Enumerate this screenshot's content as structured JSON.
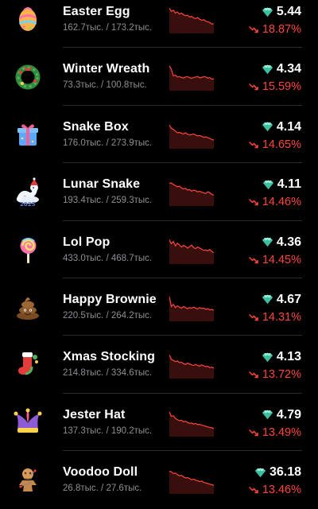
{
  "colors": {
    "background": "#000000",
    "name_text": "#ffffff",
    "stats_text": "#8e8e93",
    "negative": "#ff453a",
    "gem": "#5ee0c0"
  },
  "items": [
    {
      "name": "Easter Egg",
      "stats": "162.7тыс. / 173.2тыс.",
      "price": "5.44",
      "change": "18.87%",
      "icon": "easter-egg-icon",
      "trend": [
        0.08,
        0.22,
        0.18,
        0.3,
        0.25,
        0.35,
        0.3,
        0.38,
        0.42,
        0.4,
        0.48,
        0.45,
        0.52,
        0.55,
        0.5,
        0.58,
        0.62,
        0.6,
        0.66,
        0.7,
        0.72,
        0.8,
        0.78
      ]
    },
    {
      "name": "Winter Wreath",
      "stats": "73.3тыс. / 100.8тыс.",
      "price": "4.34",
      "change": "15.59%",
      "icon": "wreath-icon",
      "trend": [
        0.1,
        0.25,
        0.55,
        0.52,
        0.6,
        0.58,
        0.62,
        0.65,
        0.6,
        0.58,
        0.63,
        0.66,
        0.62,
        0.6,
        0.58,
        0.64,
        0.62,
        0.58,
        0.6,
        0.65,
        0.63,
        0.7,
        0.68
      ]
    },
    {
      "name": "Snake Box",
      "stats": "176.0тыс. / 273.9тыс.",
      "price": "4.14",
      "change": "14.65%",
      "icon": "gift-box-icon",
      "trend": [
        0.15,
        0.3,
        0.35,
        0.42,
        0.5,
        0.48,
        0.52,
        0.55,
        0.5,
        0.56,
        0.6,
        0.58,
        0.55,
        0.6,
        0.64,
        0.62,
        0.66,
        0.7,
        0.68,
        0.72,
        0.75,
        0.8,
        0.82
      ]
    },
    {
      "name": "Lunar Snake",
      "stats": "193.4тыс. / 259.3тыс.",
      "price": "4.11",
      "change": "14.46%",
      "icon": "snake-icon",
      "trend": [
        0.2,
        0.18,
        0.25,
        0.3,
        0.35,
        0.32,
        0.4,
        0.45,
        0.42,
        0.5,
        0.48,
        0.55,
        0.5,
        0.53,
        0.58,
        0.55,
        0.6,
        0.62,
        0.65,
        0.58,
        0.62,
        0.7,
        0.72
      ]
    },
    {
      "name": "Lol Pop",
      "stats": "433.0тыс. / 468.7тыс.",
      "price": "4.36",
      "change": "14.45%",
      "icon": "lollipop-icon",
      "trend": [
        0.12,
        0.3,
        0.2,
        0.4,
        0.28,
        0.35,
        0.45,
        0.38,
        0.42,
        0.5,
        0.44,
        0.36,
        0.48,
        0.52,
        0.45,
        0.5,
        0.55,
        0.6,
        0.58,
        0.62,
        0.56,
        0.66,
        0.7
      ]
    },
    {
      "name": "Happy Brownie",
      "stats": "220.5тыс. / 264.2тыс.",
      "price": "4.67",
      "change": "14.31%",
      "icon": "brownie-icon",
      "trend": [
        0.1,
        0.55,
        0.45,
        0.6,
        0.52,
        0.58,
        0.62,
        0.55,
        0.6,
        0.65,
        0.6,
        0.63,
        0.58,
        0.62,
        0.66,
        0.6,
        0.64,
        0.62,
        0.68,
        0.65,
        0.7,
        0.68,
        0.72
      ]
    },
    {
      "name": "Xmas Stocking",
      "stats": "214.8тыс. / 334.6тыс.",
      "price": "4.13",
      "change": "13.72%",
      "icon": "stocking-icon",
      "trend": [
        0.15,
        0.35,
        0.4,
        0.45,
        0.42,
        0.5,
        0.48,
        0.55,
        0.58,
        0.52,
        0.56,
        0.6,
        0.62,
        0.58,
        0.62,
        0.66,
        0.6,
        0.64,
        0.68,
        0.66,
        0.72,
        0.7,
        0.75
      ]
    },
    {
      "name": "Jester Hat",
      "stats": "137.3тыс. / 190.2тыс.",
      "price": "4.79",
      "change": "13.49%",
      "icon": "jester-hat-icon",
      "trend": [
        0.1,
        0.3,
        0.28,
        0.4,
        0.45,
        0.5,
        0.48,
        0.55,
        0.52,
        0.58,
        0.62,
        0.6,
        0.65,
        0.62,
        0.68,
        0.66,
        0.7,
        0.72,
        0.75,
        0.78,
        0.8,
        0.82,
        0.85
      ]
    },
    {
      "name": "Voodoo Doll",
      "stats": "26.8тыс. / 27.6тыс.",
      "price": "36.18",
      "change": "13.46%",
      "icon": "voodoo-doll-icon",
      "trend": [
        0.2,
        0.22,
        0.3,
        0.28,
        0.35,
        0.4,
        0.38,
        0.45,
        0.5,
        0.48,
        0.52,
        0.58,
        0.55,
        0.6,
        0.62,
        0.66,
        0.64,
        0.7,
        0.72,
        0.75,
        0.78,
        0.8,
        0.84
      ]
    }
  ]
}
